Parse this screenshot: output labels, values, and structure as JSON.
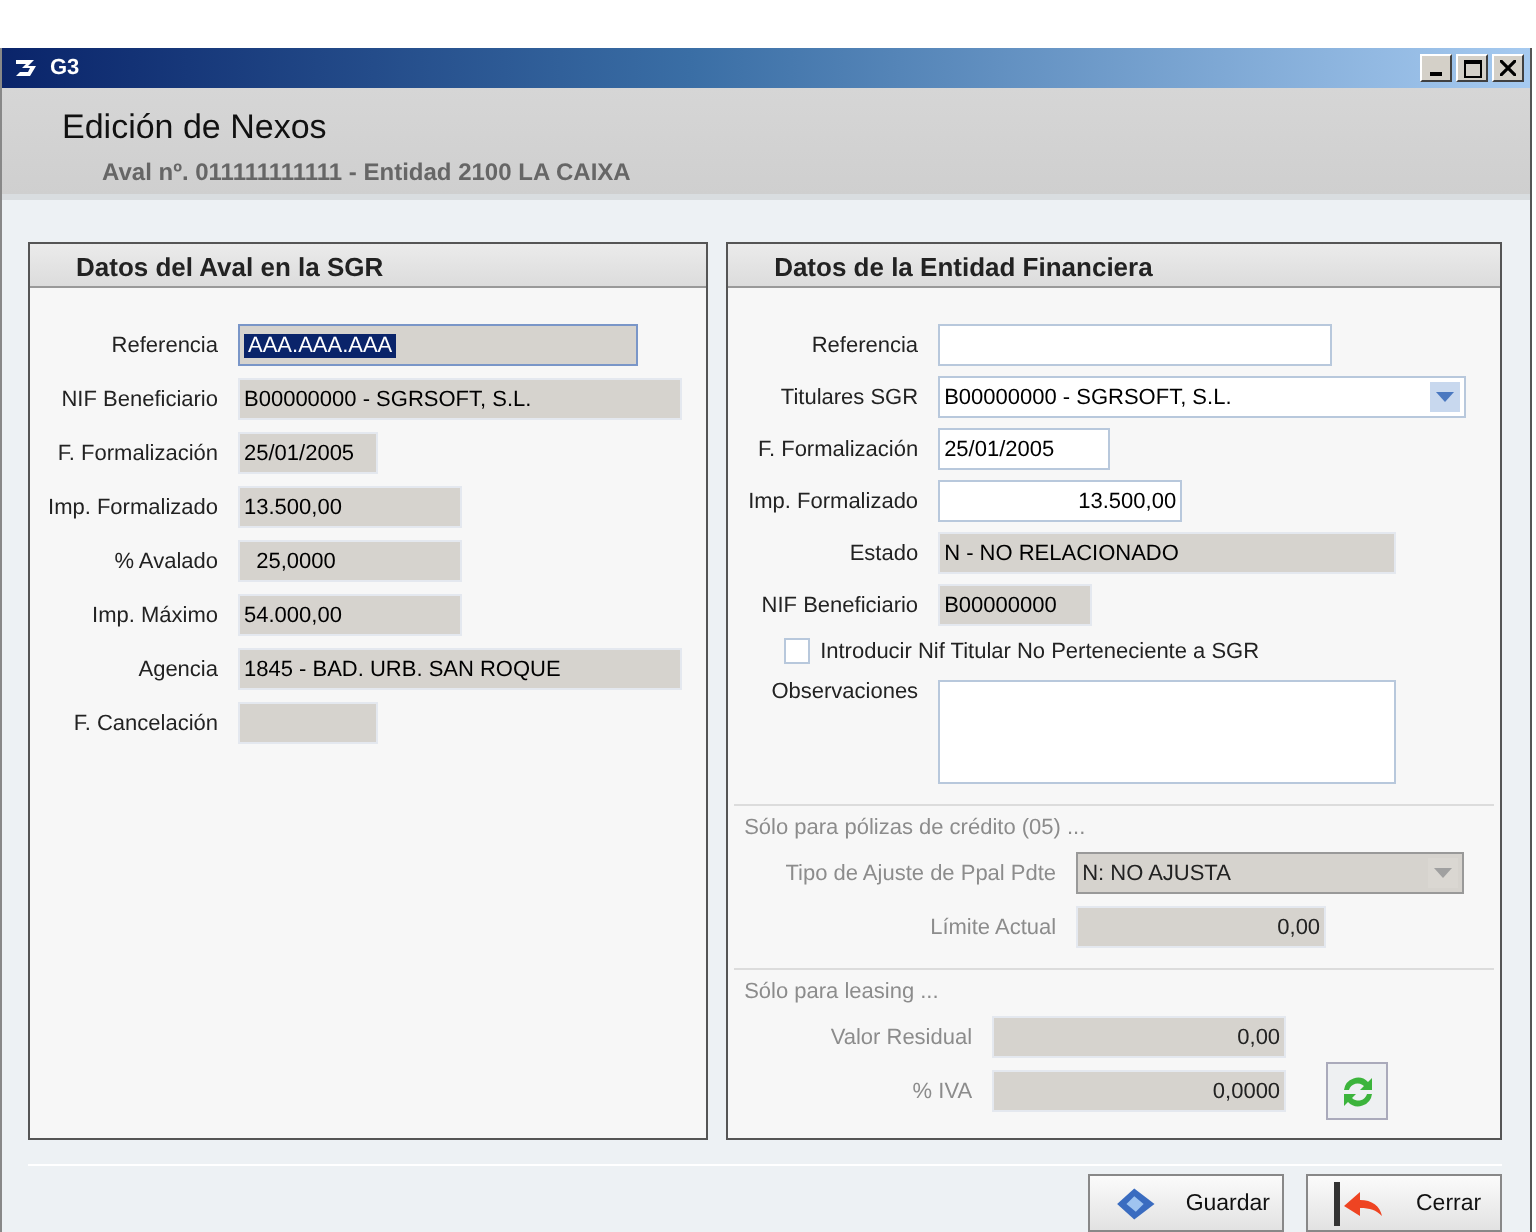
{
  "window": {
    "title": "G3"
  },
  "header": {
    "title": "Edición de Nexos",
    "subtitle": "Aval nº. 011111111111 - Entidad 2100 LA CAIXA"
  },
  "left_panel": {
    "title": "Datos del Aval en la SGR",
    "fields": [
      {
        "label": "Referencia",
        "value": "AAA.AAA.AAA",
        "readonly": true,
        "focused": true
      },
      {
        "label": "NIF Beneficiario",
        "value": "B00000000 - SGRSOFT, S.L.",
        "readonly": true,
        "focused": false
      },
      {
        "label": "F. Formalización",
        "value": "25/01/2005",
        "readonly": true,
        "focused": false
      },
      {
        "label": "Imp. Formalizado",
        "value": "13.500,00",
        "readonly": true,
        "focused": false
      },
      {
        "label": "% Avalado",
        "value": "  25,0000",
        "readonly": true,
        "focused": false
      },
      {
        "label": "Imp. Máximo",
        "value": "54.000,00",
        "readonly": true,
        "focused": false
      },
      {
        "label": "Agencia",
        "value": "1845 - BAD. URB. SAN ROQUE",
        "readonly": true,
        "focused": false
      },
      {
        "label": "F. Cancelación",
        "readonly": true,
        "focused": false
      }
    ]
  },
  "right_panel": {
    "title": "Datos de la Entidad Financiera",
    "fields": [
      {
        "label": "Referencia",
        "kind": "text",
        "readonly": false
      },
      {
        "label": "Titulares SGR",
        "value": "B00000000 - SGRSOFT, S.L.",
        "kind": "dropdown",
        "readonly": false
      },
      {
        "label": "F. Formalización",
        "value": "25/01/2005",
        "kind": "text",
        "readonly": false
      },
      {
        "label": "Imp. Formalizado",
        "value": "13.500,00",
        "kind": "number",
        "readonly": false
      },
      {
        "label": "Estado",
        "value": "N - NO RELACIONADO",
        "kind": "text",
        "readonly": true
      },
      {
        "label": "NIF Beneficiario",
        "value": "B00000000",
        "kind": "text",
        "readonly": true
      },
      {
        "label": "Introducir Nif Titular No Perteneciente a SGR",
        "kind": "checkbox",
        "checked": false
      },
      {
        "label": "Observaciones",
        "kind": "textarea",
        "readonly": false
      }
    ],
    "sections": [
      {
        "title": "Sólo para pólizas de crédito (05) ...",
        "disabled": true,
        "fields": [
          {
            "label": "Tipo de Ajuste de Ppal Pdte",
            "value": "N: NO AJUSTA",
            "kind": "dropdown"
          },
          {
            "label": "Límite Actual",
            "value": "0,00",
            "kind": "number"
          }
        ]
      },
      {
        "title": "Sólo para leasing ...",
        "disabled": true,
        "refresh": true,
        "fields": [
          {
            "label": "Valor Residual",
            "value": "0,00",
            "kind": "number"
          },
          {
            "label": "% IVA",
            "value": "0,0000",
            "kind": "number"
          }
        ]
      }
    ]
  },
  "buttons": [
    {
      "label": "Guardar",
      "kind": "save"
    },
    {
      "label": "Cerrar",
      "kind": "close"
    }
  ]
}
